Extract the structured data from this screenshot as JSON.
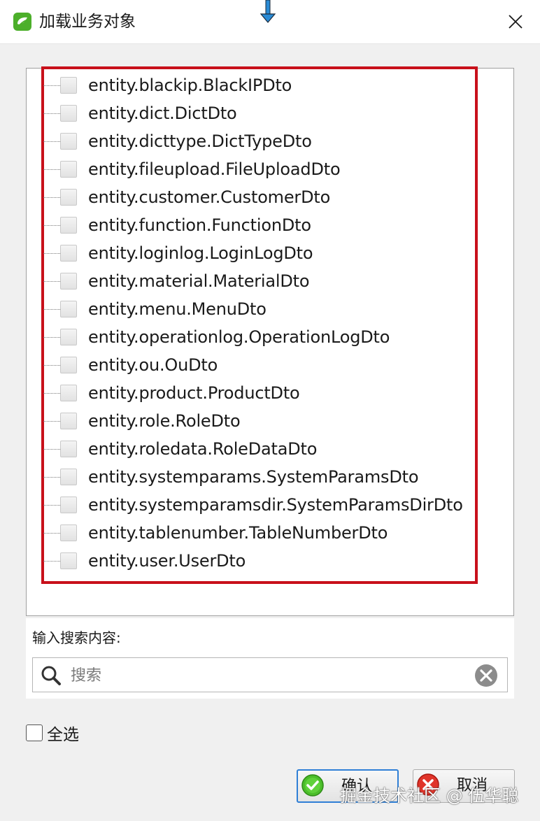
{
  "window": {
    "title": "加载业务对象",
    "app_icon": "green-leaf-app-icon",
    "close_icon": "close-x-icon"
  },
  "tree": {
    "items": [
      {
        "label": "entity.blackip.BlackIPDto",
        "checked": false
      },
      {
        "label": "entity.dict.DictDto",
        "checked": false
      },
      {
        "label": "entity.dicttype.DictTypeDto",
        "checked": false
      },
      {
        "label": "entity.fileupload.FileUploadDto",
        "checked": false
      },
      {
        "label": "entity.customer.CustomerDto",
        "checked": false
      },
      {
        "label": "entity.function.FunctionDto",
        "checked": false
      },
      {
        "label": "entity.loginlog.LoginLogDto",
        "checked": false
      },
      {
        "label": "entity.material.MaterialDto",
        "checked": false
      },
      {
        "label": "entity.menu.MenuDto",
        "checked": false
      },
      {
        "label": "entity.operationlog.OperationLogDto",
        "checked": false
      },
      {
        "label": "entity.ou.OuDto",
        "checked": false
      },
      {
        "label": "entity.product.ProductDto",
        "checked": false
      },
      {
        "label": "entity.role.RoleDto",
        "checked": false
      },
      {
        "label": "entity.roledata.RoleDataDto",
        "checked": false
      },
      {
        "label": "entity.systemparams.SystemParamsDto",
        "checked": false
      },
      {
        "label": "entity.systemparamsdir.SystemParamsDirDto",
        "checked": false
      },
      {
        "label": "entity.tablenumber.TableNumberDto",
        "checked": false
      },
      {
        "label": "entity.user.UserDto",
        "checked": false
      }
    ],
    "highlight_color": "#c8101b"
  },
  "search": {
    "label": "输入搜索内容:",
    "value": "",
    "placeholder": "搜索",
    "search_icon": "magnifier-icon",
    "clear_icon": "clear-circle-icon"
  },
  "select_all": {
    "label": "全选",
    "checked": false
  },
  "buttons": {
    "ok_label": "确认",
    "ok_icon": "green-check-icon",
    "cancel_label": "取消",
    "cancel_icon": "red-x-icon"
  },
  "watermark": "掘金技术社区 @ 伍华聪",
  "colors": {
    "accent": "#2f7fd6",
    "highlight": "#c8101b"
  }
}
